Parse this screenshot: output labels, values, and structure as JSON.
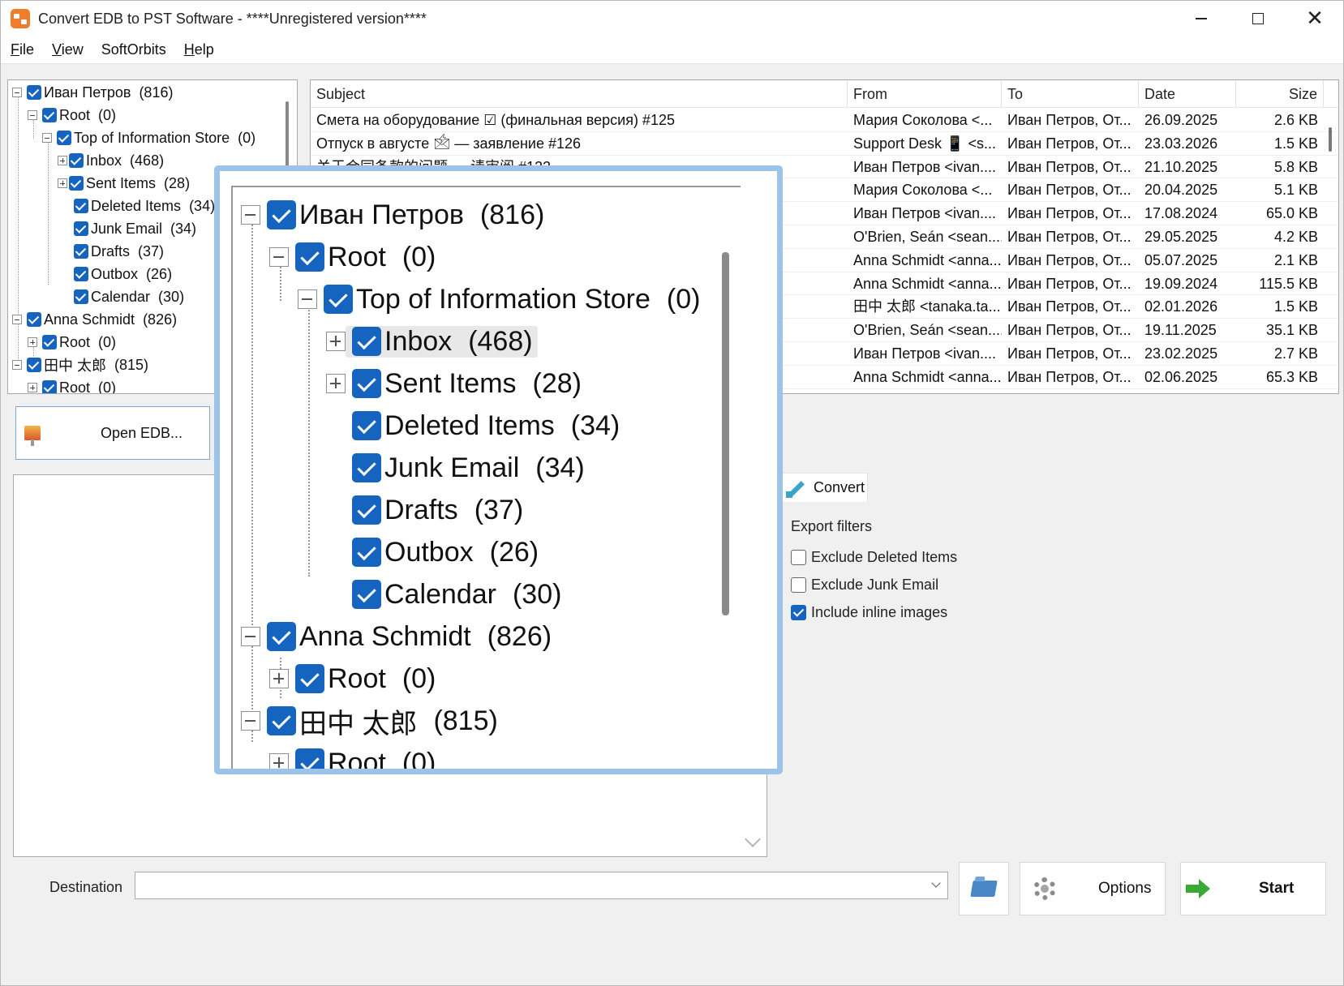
{
  "window": {
    "title": "Convert EDB to PST Software - ****Unregistered version****"
  },
  "menu": [
    {
      "first": "F",
      "rest": "ile"
    },
    {
      "first": "V",
      "rest": "iew"
    },
    {
      "first": "",
      "rest": "SoftOrbits"
    },
    {
      "first": "H",
      "rest": "elp"
    }
  ],
  "tree": {
    "mailbox1": {
      "name": "Иван Петров",
      "count": "(816)"
    },
    "root1": {
      "name": "Root",
      "count": "(0)"
    },
    "top_store": {
      "name": "Top of Information Store",
      "count": "(0)"
    },
    "inbox": {
      "name": "Inbox",
      "count": "(468)"
    },
    "sent": {
      "name": "Sent Items",
      "count": "(28)"
    },
    "deleted": {
      "name": "Deleted Items",
      "count": "(34)"
    },
    "junk": {
      "name": "Junk Email",
      "count": "(34)"
    },
    "drafts": {
      "name": "Drafts",
      "count": "(37)"
    },
    "outbox": {
      "name": "Outbox",
      "count": "(26)"
    },
    "calendar": {
      "name": "Calendar",
      "count": "(30)"
    },
    "mailbox2": {
      "name": "Anna Schmidt",
      "count": "(826)"
    },
    "root2": {
      "name": "Root",
      "count": "(0)"
    },
    "mailbox3": {
      "name": "田中 太郎",
      "count": "(815)"
    },
    "root3": {
      "name": "Root",
      "count": "(0)"
    }
  },
  "list": {
    "headers": {
      "subject": "Subject",
      "from": "From",
      "to": "To",
      "date": "Date",
      "size": "Size"
    },
    "rows": [
      {
        "subject": "Смета на оборудование ☑ (финальная версия) #125",
        "from": "Мария Соколова <...",
        "to": "Иван Петров, От...",
        "date": "26.09.2025",
        "size": "2.6 KB"
      },
      {
        "subject": "Отпуск в августе 🖄 — заявление #126",
        "from": "Support Desk 📱 <s...",
        "to": "Иван Петров, От...",
        "date": "23.03.2026",
        "size": "1.5 KB"
      },
      {
        "subject": "关于合同条款的问题 — 请审阅 #122",
        "from": "Иван Петров <ivan....",
        "to": "Иван Петров, От...",
        "date": "21.10.2025",
        "size": "5.8 KB"
      },
      {
        "subject": "",
        "from": "Мария Соколова <...",
        "to": "Иван Петров, От...",
        "date": "20.04.2025",
        "size": "5.1 KB"
      },
      {
        "subject": "",
        "from": "Иван Петров <ivan....",
        "to": "Иван Петров, От...",
        "date": "17.08.2024",
        "size": "65.0 KB"
      },
      {
        "subject": "",
        "from": "O'Brien, Seán <sean....",
        "to": "Иван Петров, От...",
        "date": "29.05.2025",
        "size": "4.2 KB"
      },
      {
        "subject": "",
        "from": "Anna Schmidt <anna...",
        "to": "Иван Петров, От...",
        "date": "05.07.2025",
        "size": "2.1 KB"
      },
      {
        "subject": "",
        "from": "Anna Schmidt <anna...",
        "to": "Иван Петров, От...",
        "date": "19.09.2024",
        "size": "115.5 KB"
      },
      {
        "subject": "",
        "from": "田中 太郎 <tanaka.ta...",
        "to": "Иван Петров, От...",
        "date": "02.01.2026",
        "size": "1.5 KB"
      },
      {
        "subject": "",
        "from": "O'Brien, Seán <sean....",
        "to": "Иван Петров, От...",
        "date": "19.11.2025",
        "size": "35.1 KB"
      },
      {
        "subject": "",
        "from": "Иван Петров <ivan....",
        "to": "Иван Петров, От...",
        "date": "23.02.2025",
        "size": "2.7 KB"
      },
      {
        "subject": "",
        "from": "Anna Schmidt <anna...",
        "to": "Иван Петров, От...",
        "date": "02.06.2025",
        "size": "65.3 KB"
      }
    ]
  },
  "open_button": "Open EDB...",
  "convert_tab": "Convert",
  "filters": {
    "title": "Export filters",
    "exclude_deleted": {
      "label": "Exclude Deleted Items",
      "checked": false
    },
    "exclude_junk": {
      "label": "Exclude Junk Email",
      "checked": false
    },
    "inline_images": {
      "label": "Include inline images",
      "checked": true
    }
  },
  "bottom": {
    "destination_label": "Destination",
    "destination_value": "",
    "options_label": "Options",
    "start_label": "Start"
  },
  "icons": {
    "app": "app-icon",
    "open": "open-edb-icon",
    "convert": "convert-icon",
    "browse": "folder-icon",
    "options": "gear-icon",
    "start": "start-arrow-icon"
  },
  "colors": {
    "checkbox": "#1565c0",
    "zoom_border": "#9cc4ea"
  }
}
